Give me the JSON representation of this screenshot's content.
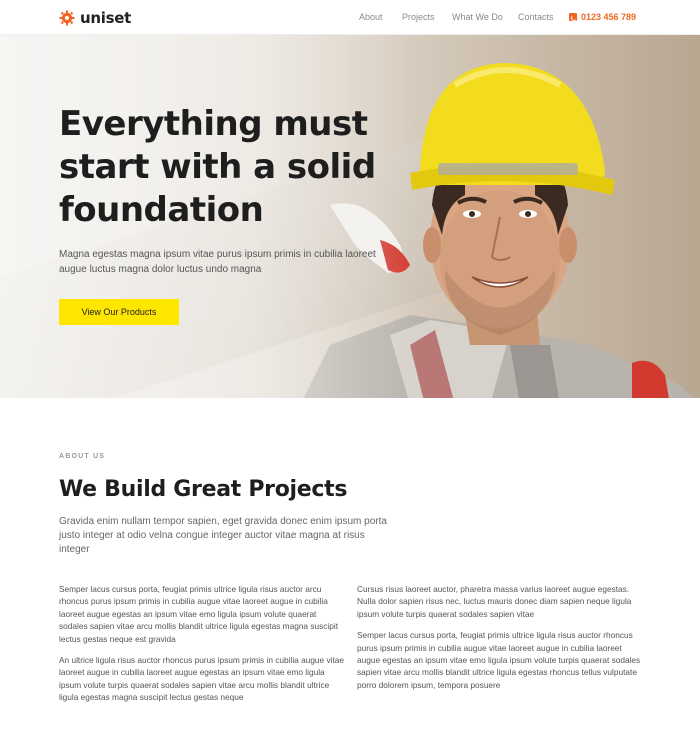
{
  "brand": {
    "name": "uniset",
    "accent": "#f26522"
  },
  "nav": {
    "items": [
      "About",
      "Projects",
      "What We Do",
      "Contacts"
    ],
    "phone": "0123 456 789"
  },
  "hero": {
    "title": "Everything must start with a solid foundation",
    "subtitle": "Magna egestas magna ipsum vitae purus ipsum primis in cubilia laoreet augue luctus magna dolor luctus undo magna",
    "button_label": "View Our Products",
    "button_color": "#ffe600"
  },
  "about": {
    "kicker": "ABOUT US",
    "title": "We Build Great Projects",
    "lead": "Gravida enim nullam tempor sapien, eget gravida donec enim ipsum porta justo integer at odio velna congue integer auctor vitae magna at risus integer",
    "left_paragraphs": [
      "Semper lacus cursus porta, feugiat primis ultrice ligula risus auctor arcu rhoncus purus ipsum primis in cubilia augue vitae laoreet augue in cubilia laoreet augue egestas an ipsum vitae emo ligula ipsum volute quaerat sodales sapien vitae arcu mollis blandit ultrice ligula egestas magna suscipit lectus gestas neque est gravida",
      "An ultrice ligula risus auctor rhoncus purus ipsum primis in cubilia augue vitae laoreet augue in cubilia laoreet augue egestas an ipsum vitae emo ligula ipsum volute turpis quaerat sodales sapien vitae arcu mollis blandit ultrice ligula egestas magna suscipit lectus gestas neque"
    ],
    "right_paragraphs": [
      "Cursus risus laoreet auctor, pharetra massa varius laoreet augue egestas. Nulla dolor sapien risus nec, luctus mauris donec diam sapien neque ligula ipsum volute turpis quaerat sodales sapien vitae",
      "Semper lacus cursus porta, feugiat primis ultrice ligula risus auctor rhoncus purus ipsum primis in cubilia augue vitae laoreet augue in cubilia laoreet augue egestas an ipsum vitae emo ligula ipsum volute turpis quaerat sodales sapien vitae arcu mollis blandit ultrice ligula egestas rhoncus tellus vulputate porro dolorem ipsum, tempora posuere"
    ]
  }
}
